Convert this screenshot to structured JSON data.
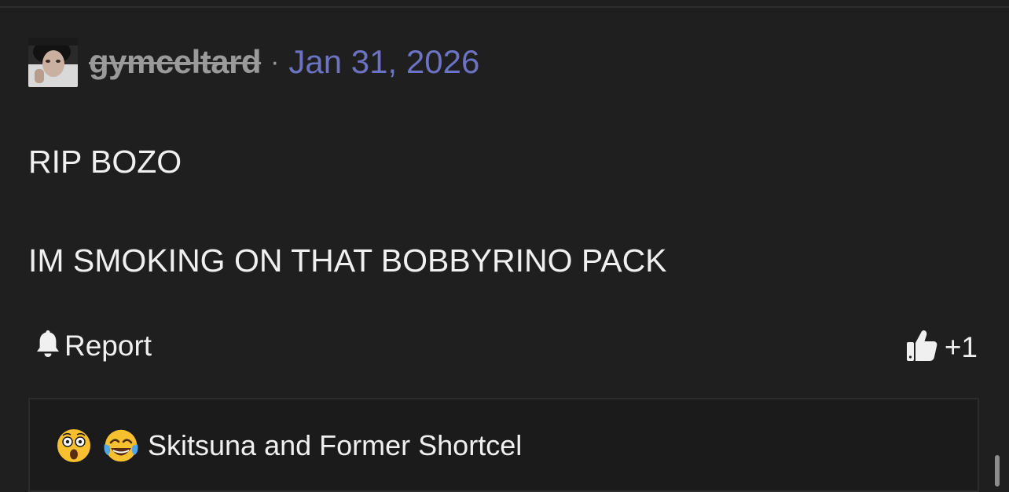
{
  "post": {
    "author": "gymceltard",
    "separator": "·",
    "date": "Jan 31, 2026",
    "body_lines": [
      "RIP BOZO",
      "IM SMOKING ON THAT BOBBYRINO PACK"
    ],
    "avatar_icon": "user-avatar"
  },
  "actions": {
    "report_label": "Report",
    "report_icon": "bell-icon",
    "like_icon": "thumbs-up-icon",
    "like_count": "+1"
  },
  "reactions": {
    "emojis": [
      "astonished-face-emoji",
      "crying-laughing-face-emoji"
    ],
    "users_text": "Skitsuna and Former Shortcel"
  },
  "colors": {
    "background": "#1f1f1f",
    "author_muted": "#9a9a9a",
    "date_link": "#6b73c2",
    "text": "#f0f0f0"
  }
}
